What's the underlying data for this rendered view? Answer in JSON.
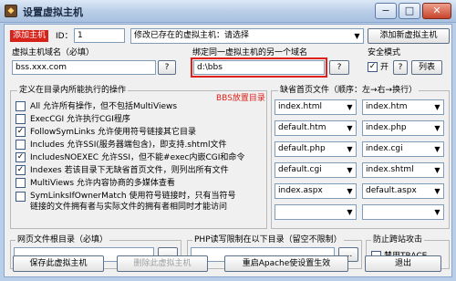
{
  "window": {
    "title": "设置虚拟主机",
    "controls": [
      "−",
      "□",
      "✕"
    ]
  },
  "header": {
    "add_label": "添加主机",
    "id_label": "ID：",
    "id_value": "1",
    "host_select_value": "修改已存在的虚拟主机：请选择",
    "add_new_button": "添加新虚拟主机"
  },
  "domain": {
    "label": "虚拟主机域名（必填）",
    "value": "bss.xxx.com",
    "help_button": "?"
  },
  "alias": {
    "label": "绑定同一虚拟主机的另一个域名",
    "value": "d:\\bbs",
    "help_button": "?",
    "annotation": "BBS放置目录"
  },
  "security": {
    "label": "安全模式",
    "checkbox_mark": "✓",
    "open_label": "开",
    "help_button": "?",
    "list_button": "列表"
  },
  "options": {
    "title": "定义在目录内所能执行的操作",
    "items": [
      {
        "label": "All 允许所有操作，但不包括MultiViews",
        "checked": false
      },
      {
        "label": "ExecCGI 允许执行CGI程序",
        "checked": false
      },
      {
        "label": "FollowSymLinks 允许使用符号链接其它目录",
        "checked": true
      },
      {
        "label": "Includes 允许SSI(服务器端包含)，即支持.shtml文件",
        "checked": false
      },
      {
        "label": "IncludesNOEXEC 允许SSI，但不能#exec内嵌CGI和命令",
        "checked": true
      },
      {
        "label": "Indexes 若该目录下无缺省首页文件，则列出所有文件",
        "checked": true
      },
      {
        "label": "MultiViews 允许内容协商的多媒体查看",
        "checked": false
      },
      {
        "label": "SymLinksIfOwnerMatch 使用符号链接时，只有当符号",
        "label2": "链接的文件拥有者与实际文件的拥有者相同时才能访问",
        "checked": false
      }
    ]
  },
  "index_pages": {
    "title": "缺省首页文件（顺序：左→右→换行）",
    "rows": [
      [
        "index.html",
        "index.htm"
      ],
      [
        "default.htm",
        "index.php"
      ],
      [
        "default.php",
        "index.cgi"
      ],
      [
        "default.cgi",
        "index.shtml"
      ],
      [
        "index.aspx",
        "default.aspx"
      ],
      [
        "",
        ""
      ]
    ]
  },
  "webroot": {
    "label": "网页文件根目录（必填）",
    "value": "",
    "browse_button": "..."
  },
  "php_limit": {
    "label": "PHP读写限制在以下目录（留空不限制）",
    "value": "",
    "browse_button": "..."
  },
  "hotlink": {
    "label": "防止跨站攻击",
    "trace_label": "禁用TRACE"
  },
  "footer": {
    "save": "保存此虚拟主机",
    "delete": "删除此虚拟主机",
    "restart": "重启Apache使设置生效",
    "exit": "退出"
  }
}
